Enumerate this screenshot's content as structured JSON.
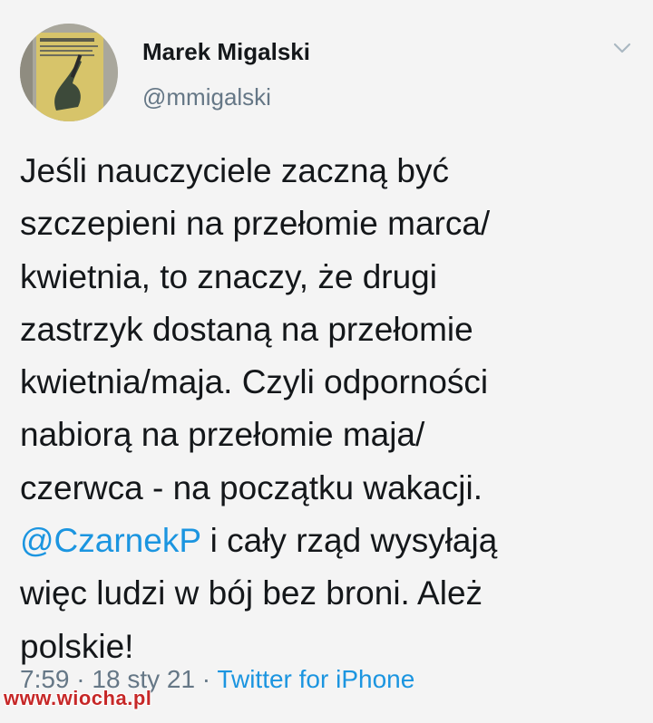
{
  "author": {
    "display_name": "Marek Migalski",
    "handle": "@mmigalski",
    "avatar_icon": "book-cover-avatar"
  },
  "menu": {
    "icon": "chevron-down-icon"
  },
  "tweet": {
    "lines": [
      "Jeśli nauczyciele zaczną być",
      "szczepieni na przełomie marca/",
      "kwietnia, to znaczy, że drugi",
      "zastrzyk dostaną na przełomie",
      "kwietnia/maja. Czyli odporności",
      "nabiorą na przełomie maja/",
      "czerwca - na początku wakacji."
    ],
    "mention": "@CzarnekP",
    "mention_rest": " i cały rząd wysyłają",
    "lines_after": [
      "więc ludzi w bój bez broni. Ależ",
      "polskie!"
    ]
  },
  "meta": {
    "time": "7:59",
    "sep1": " · ",
    "date": "18 sty 21",
    "sep2": " · ",
    "source": "Twitter for iPhone"
  },
  "watermark": "www.wiocha.pl",
  "colors": {
    "background": "#f4f4f4",
    "text": "#14171a",
    "secondary": "#657786",
    "link": "#1b95e0"
  }
}
